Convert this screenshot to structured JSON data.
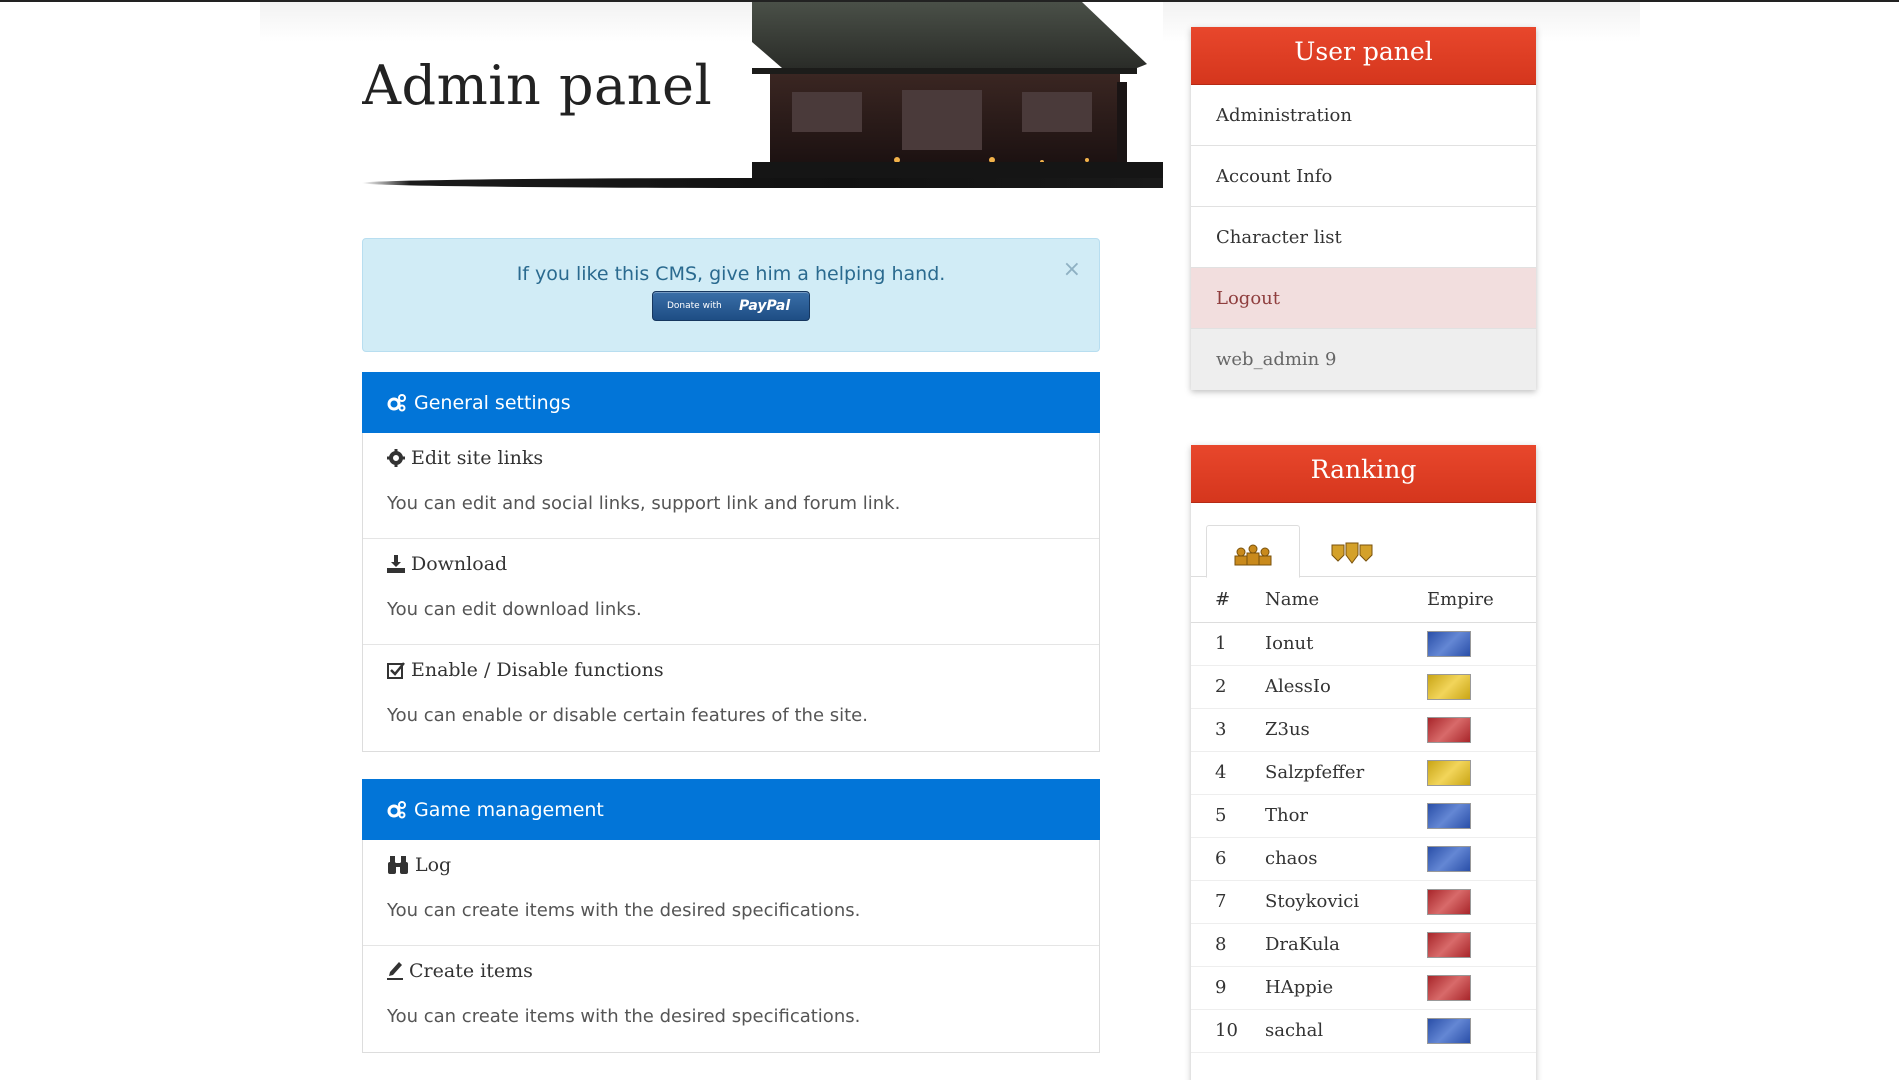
{
  "header": {
    "title": "Admin panel"
  },
  "alert": {
    "text": "If you like this CMS, give him a helping hand.",
    "close": "×",
    "paypal_small": "Donate with",
    "paypal_brand": "PayPal"
  },
  "panels": [
    {
      "title": "General settings",
      "icon": "cogs-icon",
      "items": [
        {
          "icon": "cog-icon",
          "title": "Edit site links",
          "desc": "You can edit and social links, support link and forum link."
        },
        {
          "icon": "download-icon",
          "title": "Download",
          "desc": "You can edit download links."
        },
        {
          "icon": "check-square-icon",
          "title": "Enable / Disable functions",
          "desc": "You can enable or disable certain features of the site."
        }
      ]
    },
    {
      "title": "Game management",
      "icon": "cogs-icon",
      "items": [
        {
          "icon": "binoculars-icon",
          "title": "Log",
          "desc": "You can create items with the desired specifications."
        },
        {
          "icon": "pen-icon",
          "title": "Create items",
          "desc": "You can create items with the desired specifications."
        }
      ]
    }
  ],
  "user_panel": {
    "title": "User panel",
    "items": [
      "Administration",
      "Account Info",
      "Character list",
      "Logout"
    ],
    "username": "web_admin 9"
  },
  "ranking": {
    "title": "Ranking",
    "tabs": [
      "players-icon",
      "guilds-icon"
    ],
    "columns": [
      "#",
      "Name",
      "Empire"
    ],
    "rows": [
      {
        "rank": "1",
        "name": "Ionut",
        "empire": "blue"
      },
      {
        "rank": "2",
        "name": "AlessIo",
        "empire": "yellow"
      },
      {
        "rank": "3",
        "name": "Z3us",
        "empire": "red"
      },
      {
        "rank": "4",
        "name": "Salzpfeffer",
        "empire": "yellow"
      },
      {
        "rank": "5",
        "name": "Thor",
        "empire": "blue"
      },
      {
        "rank": "6",
        "name": "chaos",
        "empire": "blue"
      },
      {
        "rank": "7",
        "name": "Stoykovici",
        "empire": "red"
      },
      {
        "rank": "8",
        "name": "DraKula",
        "empire": "red"
      },
      {
        "rank": "9",
        "name": "HAppie",
        "empire": "red"
      },
      {
        "rank": "10",
        "name": "sachal",
        "empire": "blue"
      }
    ]
  },
  "colors": {
    "panel_header": "#0275d8",
    "sidebar_header": "#e03f25",
    "alert_bg": "#d1ecf6",
    "logout_bg": "#f2dede"
  }
}
